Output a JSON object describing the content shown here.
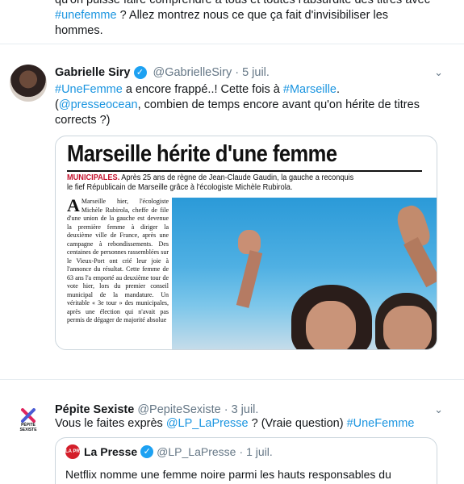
{
  "previous_tweet": {
    "line1": "qu'on puisse faire comprendre à tous et toutes l'absurdité des titres avec",
    "hashtag": "#unefemme",
    "line2_rest": " ? Allez montrez nous ce que ça fait d'invisibiliser les hommes."
  },
  "tweet1": {
    "name": "Gabrielle Siry",
    "handle": "@GabrielleSiry",
    "dot": "·",
    "time": "5 juil.",
    "caret": "⌄",
    "hashtag1": "#UneFemme",
    "text1": " a encore frappé..! Cette fois à ",
    "hashtag2": "#Marseille",
    "text2": ".",
    "mention": "@presseocean",
    "text3_pre": "(",
    "text3": ", combien de temps encore avant qu'on hérite de titres",
    "text4": "corrects ?)",
    "media": {
      "headline": "Marseille hérite d'une femme",
      "label": "MUNICIPALES.",
      "subhead_rest": " Après 25 ans de règne de Jean-Claude Gaudin, la gauche a reconquis",
      "subhead_line2": "le fief Républicain de Marseille grâce à l'écologiste Michèle Rubirola.",
      "dropcap": "A",
      "column_text": "Marseille hier, l'écologiste Michèle Rubirola, cheffe de file d'une union de la gauche est devenue la première femme à diriger la deuxième ville de France, après une campagne à rebondissements. Des centaines de personnes rassemblées sur le Vieux-Port ont crié leur joie à l'annonce du résultat. Cette femme de 63 ans l'a emporté au deuxième tour de vote hier, lors du premier conseil municipal de la mandature. Un véritable « 3e tour » des municipales, après une élection qui n'avait pas permis de dégager de majorité absolue"
    }
  },
  "tweet2": {
    "name": "Pépite Sexiste",
    "handle": "@PepiteSexiste",
    "dot": "·",
    "time": "3 juil.",
    "caret": "⌄",
    "avatar_text1": "PÉPITE",
    "avatar_text2": "SEXISTE",
    "text1": "Vous le faites exprès ",
    "mention": "@LP_LaPresse",
    "text2": " ? (Vraie question) ",
    "hashtag": "#UneFemme",
    "quoted": {
      "logo": "LA PRESSE",
      "name": "La Presse",
      "handle": "@LP_LaPresse",
      "dot": "·",
      "time": "1 juil.",
      "text": "Netflix nomme une femme noire parmi les hauts responsables du groupe"
    }
  },
  "colors": {
    "link": "#1b95e0",
    "verified": "#1da1f2",
    "secondary_text": "#657786",
    "separator": "#e6ecf0",
    "brand_red": "#c5142f"
  }
}
